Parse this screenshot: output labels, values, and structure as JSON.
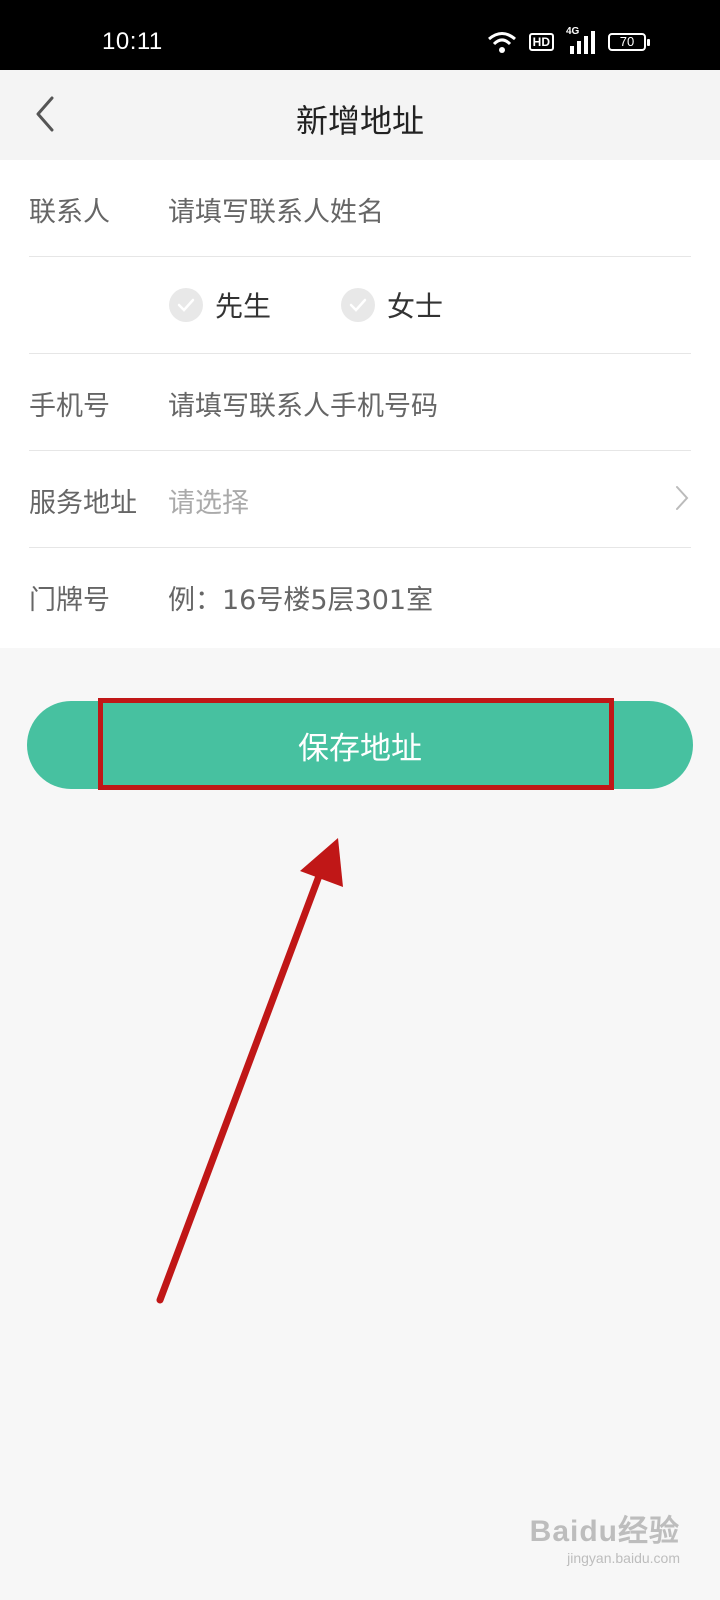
{
  "status_bar": {
    "time": "10:11",
    "hd_label": "HD",
    "network_label": "4G",
    "battery": "70"
  },
  "nav": {
    "title": "新增地址",
    "back_icon": "chevron-left-icon"
  },
  "form": {
    "contact": {
      "label": "联系人",
      "placeholder": "请填写联系人姓名"
    },
    "gender": {
      "options": [
        "先生",
        "女士"
      ],
      "icon": "check-circle-icon"
    },
    "phone": {
      "label": "手机号",
      "placeholder": "请填写联系人手机号码"
    },
    "service_address": {
      "label": "服务地址",
      "placeholder": "请选择",
      "icon": "chevron-right-icon"
    },
    "door_number": {
      "label": "门牌号",
      "placeholder": "例：16号楼5层301室"
    }
  },
  "save_button": {
    "label": "保存地址"
  },
  "colors": {
    "accent": "#47c1a0",
    "annotation": "#c01717"
  },
  "watermark": {
    "main": "Baidu经验",
    "sub": "jingyan.baidu.com"
  }
}
